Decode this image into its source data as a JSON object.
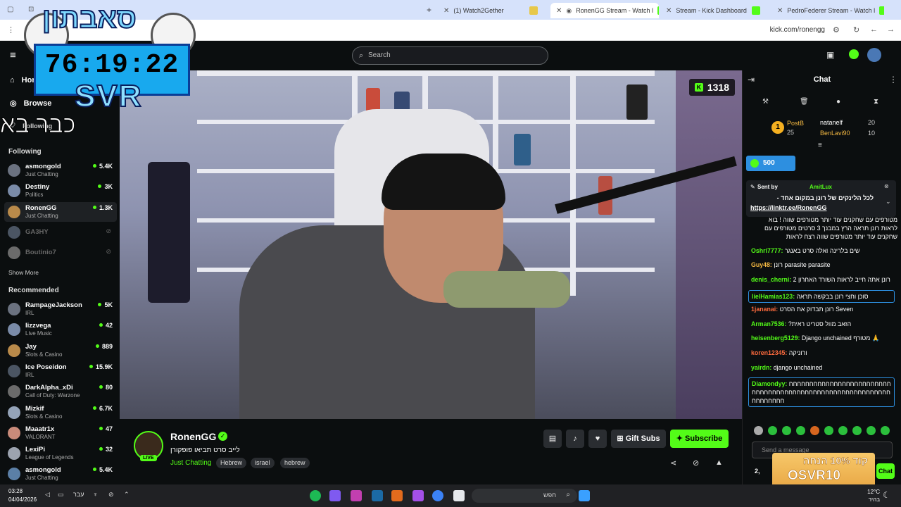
{
  "browser": {
    "tabs": [
      {
        "label": ""
      },
      {
        "label": "(1) Watch2Gether"
      },
      {
        "label": "RonenGG Stream - Watch l"
      },
      {
        "label": "Stream - Kick Dashboard"
      },
      {
        "label": "PedroFederer Stream - Watch l"
      }
    ],
    "url": "kick.com/ronengg"
  },
  "header": {
    "search_placeholder": "Search"
  },
  "overlay": {
    "top_text": "סאבתון",
    "timer": "76:19:22",
    "svr": "SVR",
    "bottom_text": "כבר בא"
  },
  "sidebar": {
    "nav": [
      {
        "label": "Home"
      },
      {
        "label": "Browse"
      },
      {
        "label": "Following"
      }
    ],
    "following_title": "Following",
    "following": [
      {
        "name": "asmongold",
        "category": "Just Chatting",
        "viewers": "5.4K",
        "live": true
      },
      {
        "name": "Destiny",
        "category": "Politics",
        "viewers": "3K",
        "live": true
      },
      {
        "name": "RonenGG",
        "category": "Just Chatting",
        "viewers": "1.3K",
        "live": true
      },
      {
        "name": "GA3HY",
        "live": false
      },
      {
        "name": "Boutinio7",
        "live": false
      }
    ],
    "show_more": "Show More",
    "recommended_title": "Recommended",
    "recommended": [
      {
        "name": "RampageJackson",
        "category": "IRL",
        "viewers": "5K"
      },
      {
        "name": "lizzvega",
        "category": "Live Music",
        "viewers": "42"
      },
      {
        "name": "Jay",
        "category": "Slots & Casino",
        "viewers": "889"
      },
      {
        "name": "Ice Poseidon",
        "category": "IRL",
        "viewers": "15.9K"
      },
      {
        "name": "DarkAlpha_xDi",
        "category": "Call of Duty: Warzone",
        "viewers": "80"
      },
      {
        "name": "Mizkif",
        "category": "Slots & Casino",
        "viewers": "6.7K"
      },
      {
        "name": "Maaatr1x",
        "category": "VALORANT",
        "viewers": "47"
      },
      {
        "name": "LexiPi",
        "category": "League of Legends",
        "viewers": "32"
      },
      {
        "name": "asmongold",
        "category": "Just Chatting",
        "viewers": "5.4K"
      }
    ]
  },
  "video": {
    "viewer_count": "1318"
  },
  "stream": {
    "name": "RonenGG",
    "live_label": "LIVE",
    "title": "לייב סרט תביאו פופקורן",
    "category": "Just Chatting",
    "tags": [
      "Hebrew",
      "israel",
      "hebrew"
    ],
    "gift_subs": "Gift Subs",
    "subscribe": "Subscribe"
  },
  "chat": {
    "title": "Chat",
    "leaderboard": [
      {
        "rank": "1",
        "name": "PostB",
        "points": "25"
      },
      {
        "name": "natanelf",
        "points": "20"
      },
      {
        "name": "BenLavi90",
        "points": "10"
      }
    ],
    "gift_amount": "500",
    "pinned": {
      "sent_by_label": "Sent by",
      "sender": "AmitLux",
      "text": "לכל הלינקים של רונן במקום אחד -",
      "link": "https://linktr.ee/RonenGG"
    },
    "messages": [
      {
        "user": "",
        "text": "מטורפים עם שחקנים עוד יותר מטורפים שווה ! בוא לראות רונן תראה הרץ במבנך 3 סרטים מטורפים עם שחקנים עוד יותר מטורפים שווה רצח לראות",
        "color": "#ffffff"
      },
      {
        "user": "Oshri7777",
        "text": "שים בלרינה ואלה סרט באנגר",
        "color": "#53fc18"
      },
      {
        "user": "Guy48",
        "text": "רונן parasite parasite",
        "color": "#f5b942"
      },
      {
        "user": "denis_cherni",
        "text": "רונן אתה חייב לראות השורד האחרון 2",
        "color": "#53fc18"
      },
      {
        "user": "lielHamias123",
        "text": "סוכן וחצי רונן בבקשה תראה",
        "color": "#53fc18"
      },
      {
        "user": "1jananai",
        "text": "רונן תבדוק את הסרט Seven",
        "color": "#ff6b3d"
      },
      {
        "user": "Arman7536",
        "text": "?הזאב מוול סטריט ראית",
        "color": "#53fc18"
      },
      {
        "user": "heisenberg5129",
        "text": "Django unchained מטורף 🙏",
        "color": "#53fc18"
      },
      {
        "user": "koren12345",
        "text": "ורוניקה",
        "color": "#ff6b3d"
      },
      {
        "user": "yairdn",
        "text": "django unchained",
        "color": "#53fc18"
      },
      {
        "user": "Diamondyy",
        "text": "חחחחחחחחחחחחחחחחחחחחחחחחחחחחחחחחחחחחחחחחחחחחחחחחחחחחחחחחחחחחחחחחחחח",
        "color": "#53fc18"
      }
    ],
    "input_placeholder": "Send a message",
    "send_label": "Chat",
    "points": "2,"
  },
  "promo": {
    "line1": "קוד 10% הנחה",
    "line2": "OSVR10"
  },
  "taskbar": {
    "time": "03:28",
    "date": "04/04/2026",
    "lang": "עבר",
    "search": "חפש",
    "weather": "12°C",
    "weather_desc": "בהיר"
  },
  "colors": {
    "kick_green": "#53fc18",
    "background": "#0b0e0f"
  }
}
